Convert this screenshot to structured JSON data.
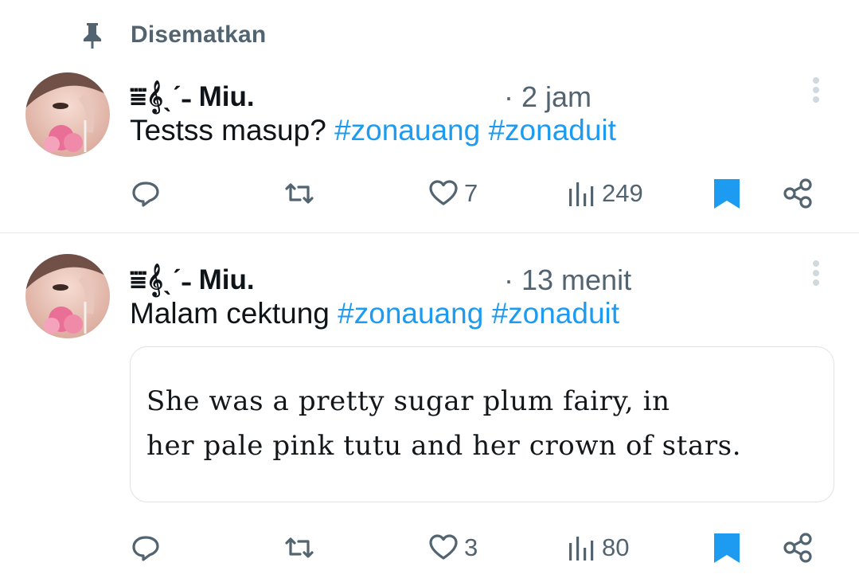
{
  "pinned": {
    "label": "Disematkan"
  },
  "tweets": [
    {
      "author": "⩸𝄞ˎˊ˗ Miu.",
      "time": "· 2 jam",
      "text_plain": "Testss masup?",
      "hashtags": [
        "#zonauang",
        "#zonaduit"
      ],
      "likes": "7",
      "views": "249"
    },
    {
      "author": "⩸𝄞ˎˊ˗ Miu.",
      "time": "· 13 menit",
      "text_plain": "Malam cektung",
      "hashtags": [
        "#zonauang",
        "#zonaduit"
      ],
      "quote": {
        "line1": "She was a pretty sugar plum fairy, in",
        "line2": "her pale pink tutu and her crown of stars."
      },
      "likes": "3",
      "views": "80"
    }
  ],
  "colors": {
    "accent": "#1d9bf0",
    "secondary_text": "#536471",
    "primary_text": "#0f1419",
    "divider": "#e6e9ec"
  },
  "icons": [
    "pin-icon",
    "reply-icon",
    "retweet-icon",
    "heart-icon",
    "views-icon",
    "bookmark-icon",
    "share-icon",
    "more-icon"
  ]
}
